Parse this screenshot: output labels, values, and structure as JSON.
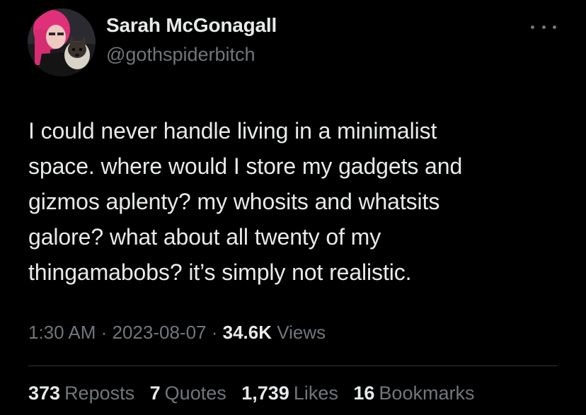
{
  "author": {
    "name": "Sarah McGonagall",
    "handle": "@gothspiderbitch"
  },
  "tweet": {
    "text_lines": [
      "I could never handle living in a minimalist",
      "space. where would I store my gadgets and",
      "gizmos aplenty? my whosits and whatsits",
      "galore? what about all twenty of my",
      "thingamabobs? it’s simply not realistic."
    ]
  },
  "meta": {
    "time": "1:30 AM",
    "separator": " · ",
    "date": "2023-08-07",
    "views_count": "34.6K",
    "views_label": "Views"
  },
  "stats": {
    "reposts": {
      "count": "373",
      "label": "Reposts"
    },
    "quotes": {
      "count": "7",
      "label": "Quotes"
    },
    "likes": {
      "count": "1,739",
      "label": "Likes"
    },
    "bookmarks": {
      "count": "16",
      "label": "Bookmarks"
    }
  },
  "icons": {
    "more": "more-horizontal-icon"
  },
  "colors": {
    "background": "#000000",
    "primary_text": "#e7e9ea",
    "secondary_text": "#71767b",
    "divider": "#2f3336"
  }
}
